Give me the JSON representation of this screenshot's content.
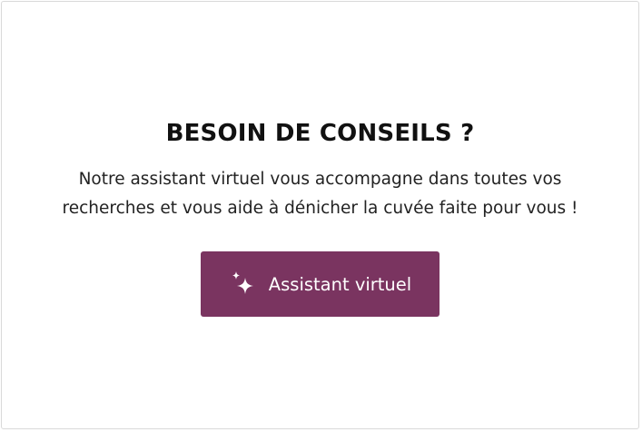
{
  "card": {
    "title": "BESOIN DE CONSEILS ?",
    "description_line1": "Notre assistant virtuel vous accompagne dans toutes vos",
    "description_line2": "recherches et vous aide à dénicher la cuvée faite pour vous !"
  },
  "cta": {
    "label": "Assistant virtuel",
    "icon": "sparkles-icon"
  },
  "colors": {
    "button_background": "#7a3460",
    "button_text": "#ffffff",
    "title_text": "#111111",
    "border": "#d9d9d9"
  }
}
